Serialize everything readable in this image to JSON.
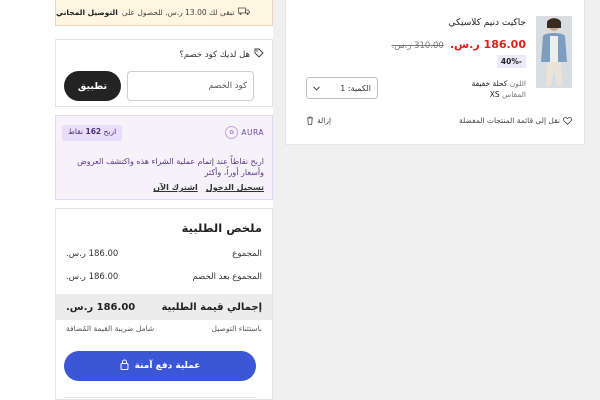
{
  "shipping_banner": {
    "text": "تبقى لك 13.00 ر.س. للحصول على",
    "bold": "التوصيل المجاني"
  },
  "coupon": {
    "question": "هل لديك كود خصم؟",
    "placeholder": "كود الخصم",
    "apply_label": "تطبيق"
  },
  "aura": {
    "brand": "AURA",
    "points_prefix": "اربح",
    "points_value": "162",
    "points_suffix": "نقاط",
    "message": "اربح نقاطاً عند إتمام عملية الشراء هذه واكتشف العروض وأسعار أوراً، وأكثر",
    "link_login": "تسجيل الدخول",
    "link_join": "اشترك الآن"
  },
  "summary": {
    "title": "ملخص الطلبية",
    "rows": [
      {
        "label": "المجموع",
        "value": "186.00 ر.س."
      },
      {
        "label": "المجموع بعد الخصم",
        "value": "186.00 ر.س."
      }
    ],
    "total_label": "إجمالي قيمة الطلبية",
    "total_value": "186.00 ر.س.",
    "note_left": "شامل ضريبة القيمة المُضافة",
    "note_right": "باستثناء التوصيل",
    "pay_label": "عملية دفع آمنة"
  },
  "cart_item": {
    "name": "جاكيت دنيم كلاسيكي",
    "price": "186.00 ر.س.",
    "old_price": "310.00 ر.س.",
    "discount": "40%-",
    "quantity_label": "الكمية: 1",
    "color_label": "اللون",
    "color_value": "كحلة خفيفة",
    "size_label": "المقاس",
    "size_value": "XS",
    "remove_label": "إزالة",
    "wishlist_label": "نقل إلى قائمة المنتجات المفضلة"
  },
  "colors": {
    "accent": "#3b56d6",
    "price_red": "#e02020",
    "dark_button": "#232323"
  }
}
